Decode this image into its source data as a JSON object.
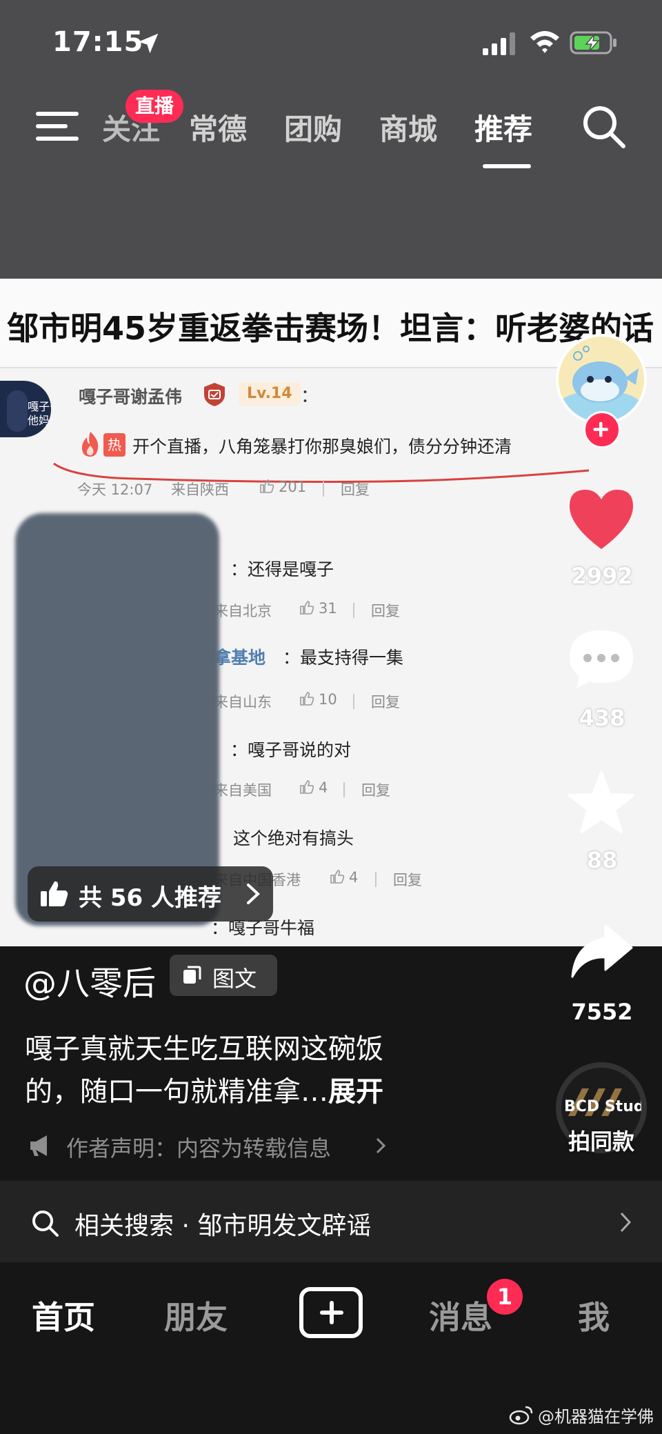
{
  "status_bar": {
    "time": "17:15"
  },
  "top_nav": {
    "live_badge": "直播",
    "tabs": [
      {
        "label": "关注"
      },
      {
        "label": "常德"
      },
      {
        "label": "团购"
      },
      {
        "label": "商城"
      },
      {
        "label": "推荐"
      }
    ],
    "active_tab": "推荐"
  },
  "video": {
    "headline": "邹市明45岁重返拳击赛场！坦言：听老婆的话",
    "top_comment": {
      "avatar_text": "嘎子哥\n他妈",
      "user": "嘎子哥谢孟伟",
      "level": "Lv.14",
      "colon": "：",
      "hot_tag": "热",
      "text": "开个直播，八角笼暴打你那臭娘们，债分分钟还清",
      "time": "今天 12:07",
      "location": "来自陕西",
      "likes": "201",
      "reply": "回复"
    },
    "replies": [
      {
        "name": "",
        "text": "：还得是嘎子",
        "location": "来自北京",
        "likes": "31",
        "reply": "回复"
      },
      {
        "name": "拿基地",
        "text": "：最支持得一集",
        "location": "来自山东",
        "likes": "10",
        "reply": "回复"
      },
      {
        "name": "",
        "text": "：嘎子哥说的对",
        "location": "来自美国",
        "likes": "4",
        "reply": "回复"
      },
      {
        "name": "",
        "text": "这个绝对有搞头",
        "location": "来自中国香港",
        "likes": "4",
        "reply": "回复"
      },
      {
        "name": "",
        "text": "：嘎子哥牛福",
        "location": "",
        "likes": "",
        "reply": ""
      }
    ],
    "recommend": "共 56 人推荐"
  },
  "rail": {
    "likes": "2992",
    "comments": "438",
    "favorites": "88",
    "shares": "7552",
    "music_label": "BCD Studio",
    "same_style": "拍同款"
  },
  "description": {
    "author": "@八零后",
    "badge": "图文",
    "line1": "嘎子真就天生吃互联网这碗饭",
    "line2": "的，随口一句就精准拿…",
    "expand": "展开",
    "declaration": "作者声明：内容为转载信息",
    "related": "相关搜索 · 邹市明发文辟谣"
  },
  "bottom_nav": {
    "home": "首页",
    "friends": "朋友",
    "messages": "消息",
    "messages_badge": "1",
    "me": "我"
  },
  "watermark": "@机器猫在学佛",
  "colors": {
    "accent": "#fe2c55",
    "like": "#f0415a"
  }
}
